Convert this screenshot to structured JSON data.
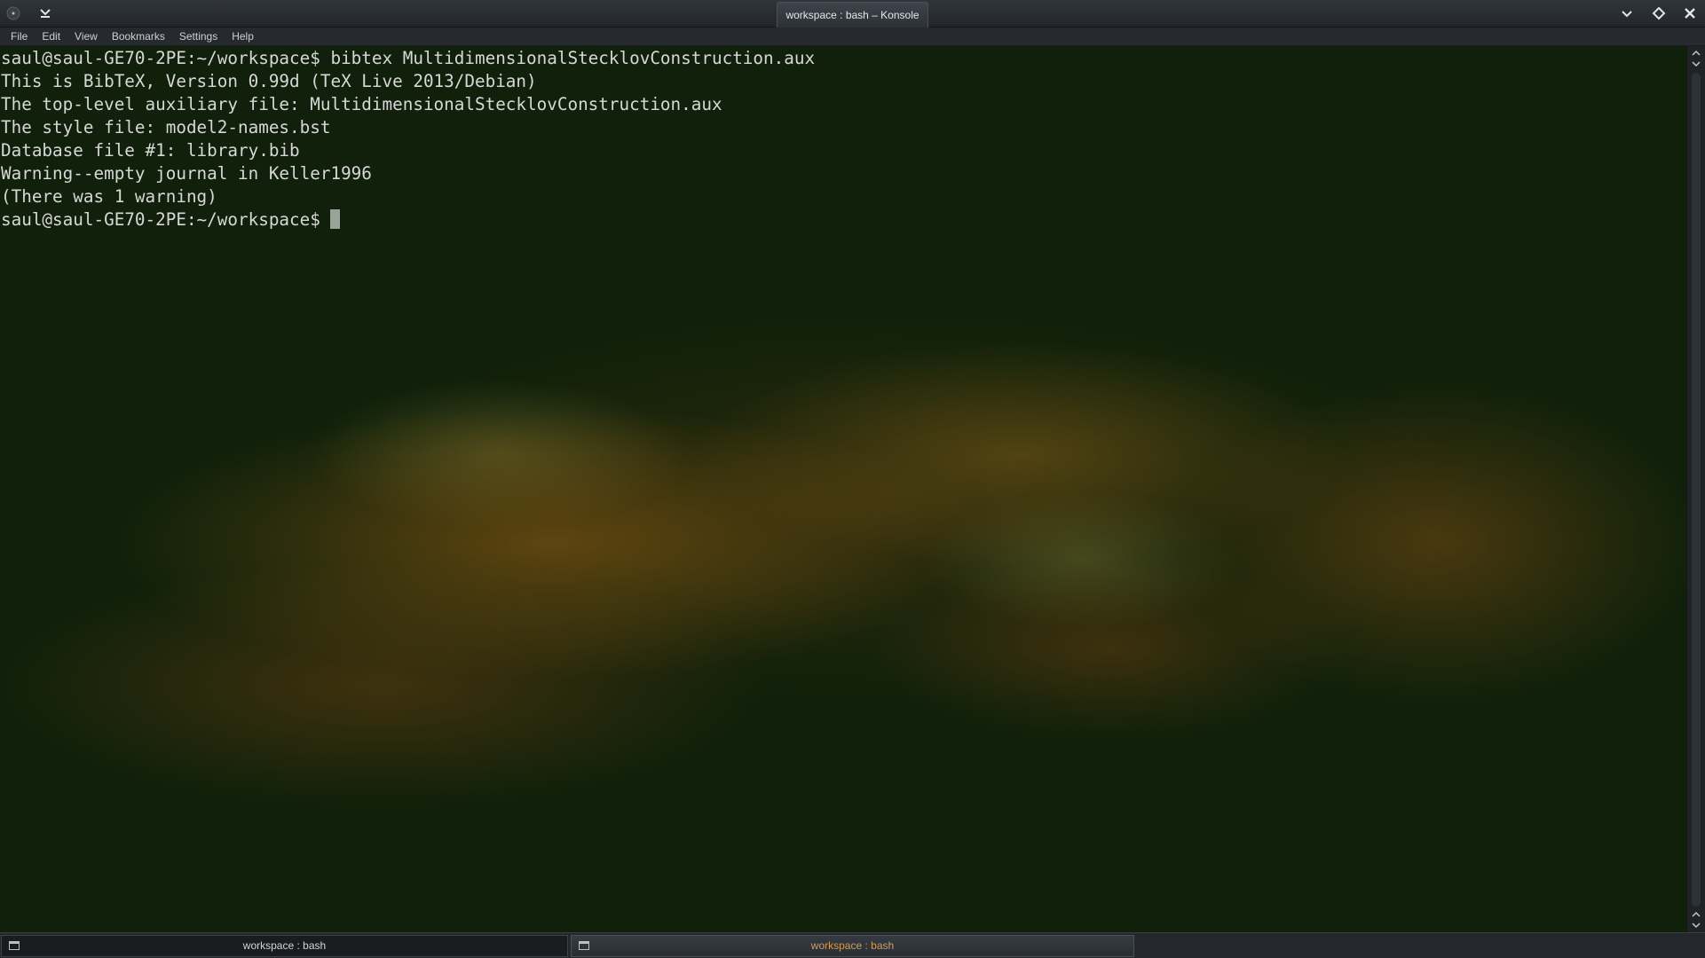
{
  "window": {
    "title": "workspace : bash – Konsole"
  },
  "titlebar": {
    "left_buttons": [
      "menu-icon",
      "keep-below-icon"
    ],
    "right_buttons": [
      "minimize-icon",
      "maximize-icon",
      "close-icon"
    ]
  },
  "menubar": {
    "items": [
      "File",
      "Edit",
      "View",
      "Bookmarks",
      "Settings",
      "Help"
    ]
  },
  "terminal": {
    "lines": [
      "saul@saul-GE70-2PE:~/workspace$ bibtex MultidimensionalStecklovConstruction.aux",
      "This is BibTeX, Version 0.99d (TeX Live 2013/Debian)",
      "The top-level auxiliary file: MultidimensionalStecklovConstruction.aux",
      "The style file: model2-names.bst",
      "Database file #1: library.bib",
      "Warning--empty journal in Keller1996",
      "(There was 1 warning)"
    ],
    "prompt": "saul@saul-GE70-2PE:~/workspace$ "
  },
  "tabs": [
    {
      "label": "workspace : bash",
      "active": false
    },
    {
      "label": "workspace : bash",
      "active": true
    }
  ],
  "colors": {
    "terminal_text": "#d7d7d7",
    "active_tab_text": "#d49a55",
    "background": "#10200a"
  }
}
